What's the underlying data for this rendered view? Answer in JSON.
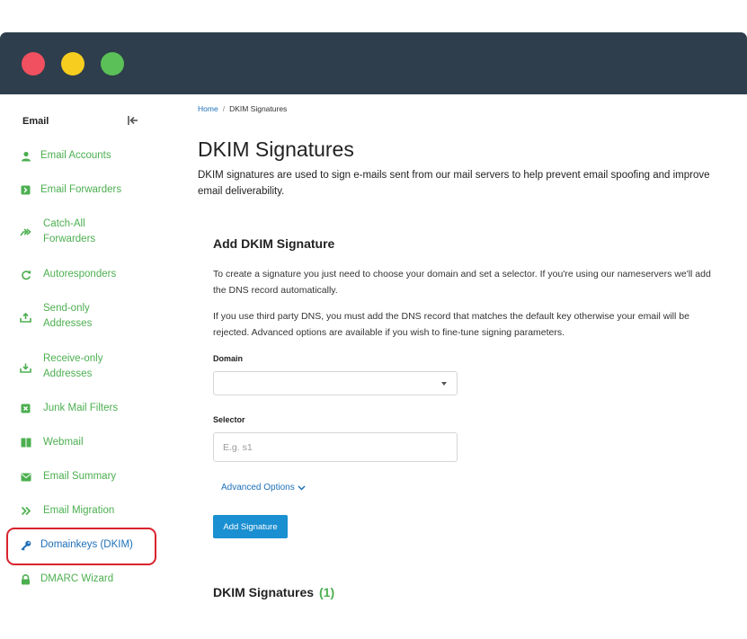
{
  "sidebar": {
    "heading": "Email",
    "items": [
      {
        "label": "Email Accounts",
        "icon": "user-icon"
      },
      {
        "label": "Email Forwarders",
        "icon": "forward-box-icon"
      },
      {
        "label": "Catch-All\nForwarders",
        "icon": "double-arrow-icon"
      },
      {
        "label": "Autoresponders",
        "icon": "refresh-icon"
      },
      {
        "label": "Send-only\nAddresses",
        "icon": "upload-tray-icon"
      },
      {
        "label": "Receive-only\nAddresses",
        "icon": "download-tray-icon"
      },
      {
        "label": "Junk Mail Filters",
        "icon": "junk-box-icon"
      },
      {
        "label": "Webmail",
        "icon": "package-icon"
      },
      {
        "label": "Email Summary",
        "icon": "envelope-icon"
      },
      {
        "label": "Email Migration",
        "icon": "chevrons-right-icon"
      },
      {
        "label": "Domainkeys (DKIM)",
        "icon": "key-icon"
      },
      {
        "label": "DMARC Wizard",
        "icon": "lock-icon"
      }
    ]
  },
  "breadcrumb": {
    "home": "Home",
    "separator": "/",
    "current": "DKIM Signatures"
  },
  "page": {
    "title": "DKIM Signatures",
    "description": "DKIM signatures are used to sign e-mails sent from our mail servers to help prevent email spoofing and improve email deliverability."
  },
  "form": {
    "title": "Add DKIM Signature",
    "para1": "To create a signature you just need to choose your domain and set a selector. If you're using our nameservers we'll add the DNS record automatically.",
    "para2": "If you use third party DNS, you must add the DNS record that matches the default key otherwise your email will be rejected. Advanced options are available if you wish to fine-tune signing parameters.",
    "domain_label": "Domain",
    "domain_value": "",
    "selector_label": "Selector",
    "selector_placeholder": "E.g. s1",
    "advanced_label": "Advanced Options",
    "submit_label": "Add Signature"
  },
  "signatures": {
    "heading": "DKIM Signatures",
    "count": "(1)"
  },
  "colors": {
    "titlebar": "#2e3e4c",
    "accent_green": "#4caf50",
    "link_blue": "#1f70b8",
    "button_blue": "#1a8fd1",
    "highlight_red": "#d9232d"
  }
}
